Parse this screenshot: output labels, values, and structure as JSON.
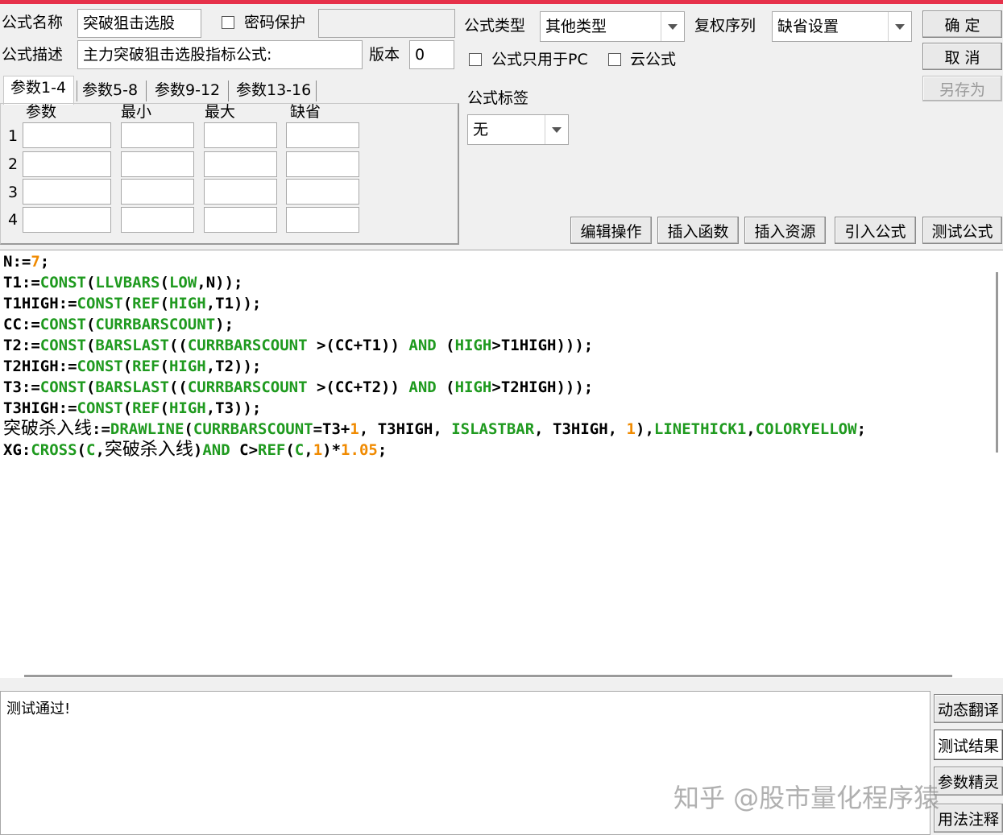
{
  "form": {
    "name_label": "公式名称",
    "name_value": "突破狙击选股",
    "password_label": "密码保护",
    "desc_label": "公式描述",
    "desc_value": "主力突破狙击选股指标公式:",
    "version_label": "版本",
    "version_value": "0",
    "type_label": "公式类型",
    "type_value": "其他类型",
    "rights_label": "复权序列",
    "rights_value": "缺省设置",
    "pc_only_label": "公式只用于PC",
    "cloud_label": "云公式",
    "tag_label": "公式标签",
    "tag_value": "无"
  },
  "buttons": {
    "ok": "确 定",
    "cancel": "取 消",
    "save_as": "另存为",
    "edit_ops": "编辑操作",
    "insert_func": "插入函数",
    "insert_res": "插入资源",
    "import_formula": "引入公式",
    "test_formula": "测试公式"
  },
  "params": {
    "tabs": [
      "参数1-4",
      "参数5-8",
      "参数9-12",
      "参数13-16"
    ],
    "headers": [
      "参数",
      "最小",
      "最大",
      "缺省"
    ],
    "rows": [
      "1",
      "2",
      "3",
      "4"
    ]
  },
  "code_lines": [
    [
      [
        "k",
        "N:="
      ],
      [
        "n",
        "7"
      ],
      [
        "k",
        ";"
      ]
    ],
    [
      [
        "k",
        "T1:="
      ],
      [
        "f",
        "CONST"
      ],
      [
        "k",
        "("
      ],
      [
        "f",
        "LLVBARS"
      ],
      [
        "k",
        "("
      ],
      [
        "f",
        "LOW"
      ],
      [
        "k",
        ",N));"
      ]
    ],
    [
      [
        "k",
        "T1HIGH:="
      ],
      [
        "f",
        "CONST"
      ],
      [
        "k",
        "("
      ],
      [
        "f",
        "REF"
      ],
      [
        "k",
        "("
      ],
      [
        "f",
        "HIGH"
      ],
      [
        "k",
        ",T1));"
      ]
    ],
    [
      [
        "k",
        "CC:="
      ],
      [
        "f",
        "CONST"
      ],
      [
        "k",
        "("
      ],
      [
        "f",
        "CURRBARSCOUNT"
      ],
      [
        "k",
        ");"
      ]
    ],
    [
      [
        "k",
        "T2:="
      ],
      [
        "f",
        "CONST"
      ],
      [
        "k",
        "("
      ],
      [
        "f",
        "BARSLAST"
      ],
      [
        "k",
        "(("
      ],
      [
        "f",
        "CURRBARSCOUNT"
      ],
      [
        "k",
        " >(CC+T1)) "
      ],
      [
        "f",
        "AND"
      ],
      [
        "k",
        " ("
      ],
      [
        "f",
        "HIGH"
      ],
      [
        "k",
        ">T1HIGH)));"
      ]
    ],
    [
      [
        "k",
        "T2HIGH:="
      ],
      [
        "f",
        "CONST"
      ],
      [
        "k",
        "("
      ],
      [
        "f",
        "REF"
      ],
      [
        "k",
        "("
      ],
      [
        "f",
        "HIGH"
      ],
      [
        "k",
        ",T2));"
      ]
    ],
    [
      [
        "k",
        "T3:="
      ],
      [
        "f",
        "CONST"
      ],
      [
        "k",
        "("
      ],
      [
        "f",
        "BARSLAST"
      ],
      [
        "k",
        "(("
      ],
      [
        "f",
        "CURRBARSCOUNT"
      ],
      [
        "k",
        " >(CC+T2)) "
      ],
      [
        "f",
        "AND"
      ],
      [
        "k",
        " ("
      ],
      [
        "f",
        "HIGH"
      ],
      [
        "k",
        ">T2HIGH)));"
      ]
    ],
    [
      [
        "k",
        "T3HIGH:="
      ],
      [
        "f",
        "CONST"
      ],
      [
        "k",
        "("
      ],
      [
        "f",
        "REF"
      ],
      [
        "k",
        "("
      ],
      [
        "f",
        "HIGH"
      ],
      [
        "k",
        ",T3));"
      ]
    ],
    [
      [
        "c",
        "突破杀入线"
      ],
      [
        "k",
        ":="
      ],
      [
        "f",
        "DRAWLINE"
      ],
      [
        "k",
        "("
      ],
      [
        "f",
        "CURRBARSCOUNT"
      ],
      [
        "k",
        "=T3+"
      ],
      [
        "n",
        "1"
      ],
      [
        "k",
        ", T3HIGH, "
      ],
      [
        "f",
        "ISLASTBAR"
      ],
      [
        "k",
        ", T3HIGH, "
      ],
      [
        "n",
        "1"
      ],
      [
        "k",
        "),"
      ],
      [
        "f",
        "LINETHICK1"
      ],
      [
        "k",
        ","
      ],
      [
        "f",
        "COLORYELLOW"
      ],
      [
        "k",
        ";"
      ]
    ],
    [
      [
        "k",
        "XG:"
      ],
      [
        "f",
        "CROSS"
      ],
      [
        "k",
        "("
      ],
      [
        "f",
        "C"
      ],
      [
        "k",
        ","
      ],
      [
        "c",
        "突破杀入线"
      ],
      [
        "k",
        ")"
      ],
      [
        "f",
        "AND"
      ],
      [
        "k",
        " C>"
      ],
      [
        "f",
        "REF"
      ],
      [
        "k",
        "("
      ],
      [
        "f",
        "C"
      ],
      [
        "k",
        ","
      ],
      [
        "n",
        "1"
      ],
      [
        "k",
        ")*"
      ],
      [
        "n",
        "1."
      ],
      [
        "n",
        "05"
      ],
      [
        "k",
        ";"
      ]
    ]
  ],
  "output": {
    "text": "测试通过!"
  },
  "side_buttons": [
    "动态翻译",
    "测试结果",
    "参数精灵",
    "用法注释"
  ],
  "watermark": "知乎 @股市量化程序猿",
  "colors": {
    "keyword_green": "#1f9a1f",
    "number_orange": "#f08a00",
    "title_bar": "#e6314a"
  }
}
